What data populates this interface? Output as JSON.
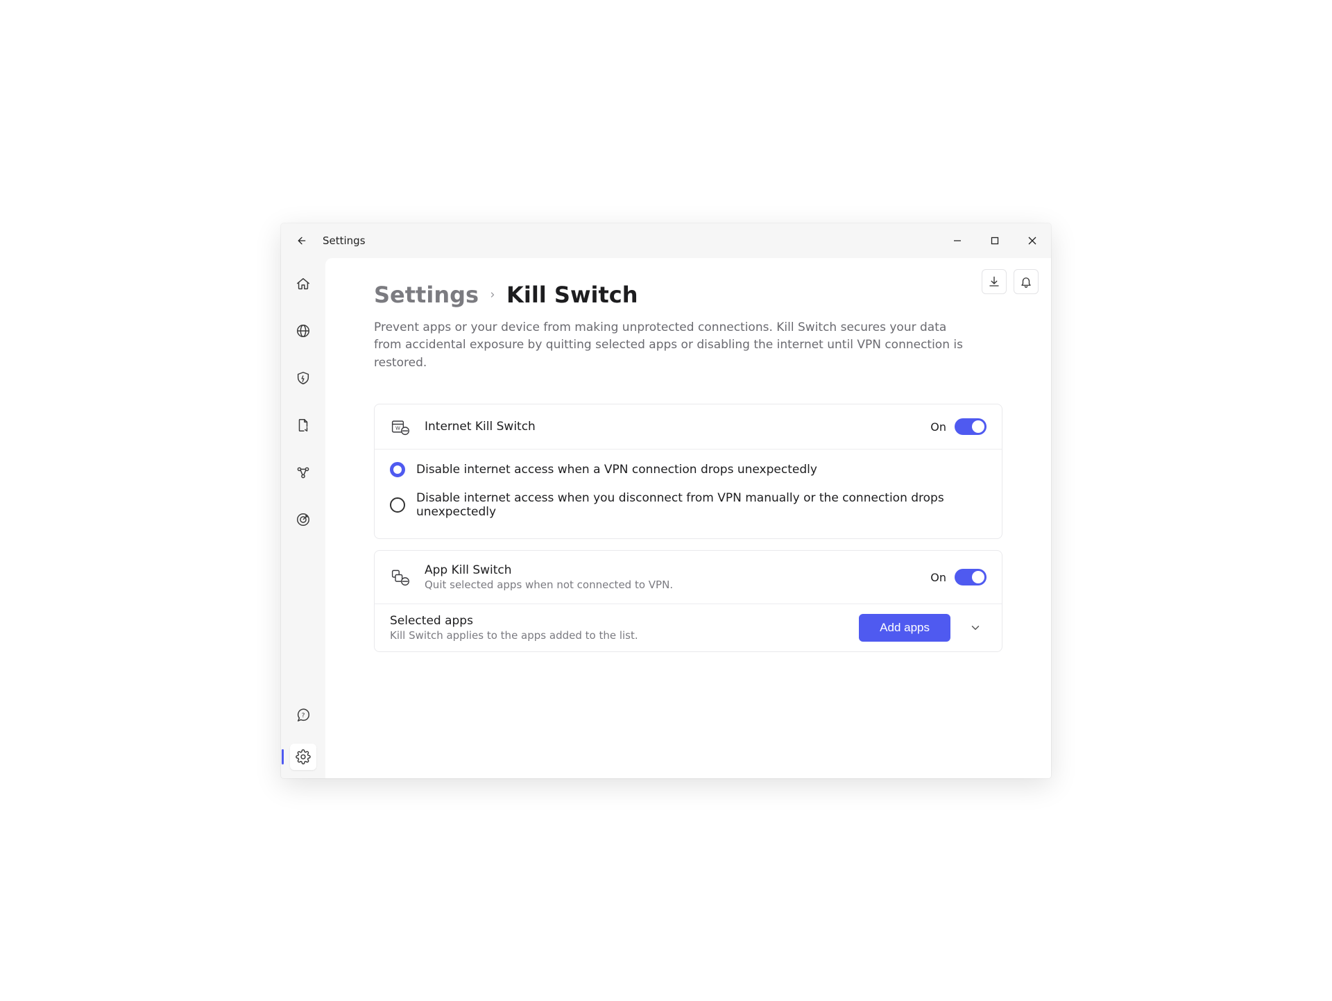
{
  "window": {
    "title": "Settings"
  },
  "breadcrumb": {
    "parent": "Settings",
    "current": "Kill Switch"
  },
  "page": {
    "description": "Prevent apps or your device from making unprotected connections. Kill Switch secures your data from accidental exposure by quitting selected apps or disabling the internet until VPN connection is restored."
  },
  "internet_ks": {
    "title": "Internet Kill Switch",
    "toggle_state": "On",
    "options": {
      "opt1": "Disable internet access when a VPN connection drops unexpectedly",
      "opt2": "Disable internet access when you disconnect from VPN manually or the connection drops unexpectedly"
    },
    "selected_option": 0
  },
  "app_ks": {
    "title": "App Kill Switch",
    "subtitle": "Quit selected apps when not connected to VPN.",
    "toggle_state": "On"
  },
  "selected_apps": {
    "title": "Selected apps",
    "subtitle": "Kill Switch applies to the apps added to the list.",
    "add_button": "Add apps"
  },
  "colors": {
    "accent": "#4f5af0"
  }
}
